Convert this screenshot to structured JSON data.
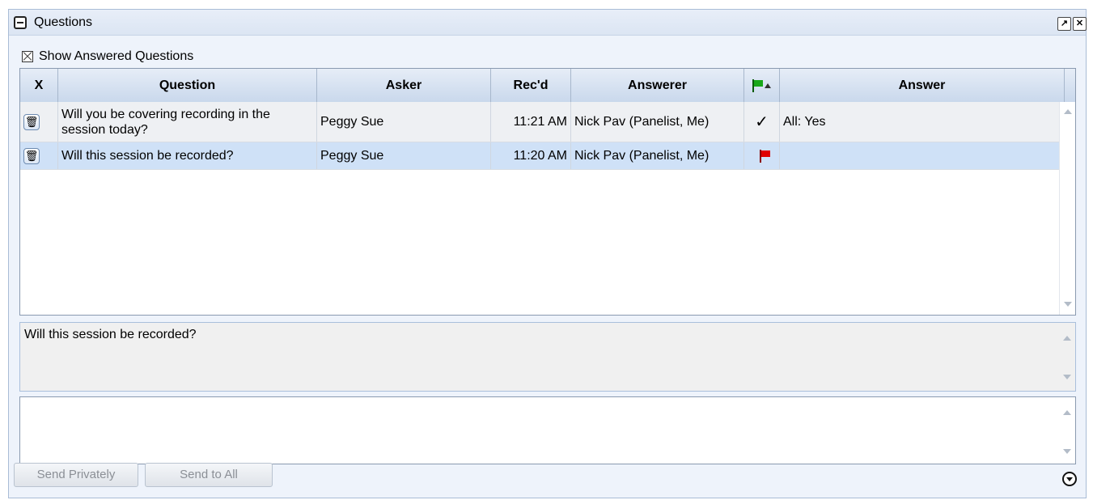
{
  "panel": {
    "title": "Questions",
    "popout_icon": "popout-icon",
    "close_icon": "close-icon"
  },
  "filter": {
    "show_answered_label": "Show Answered Questions",
    "show_answered_checked": true
  },
  "table": {
    "columns": [
      "X",
      "Question",
      "Asker",
      "Rec'd",
      "Answerer",
      "",
      "Answer"
    ],
    "rows": [
      {
        "question_line1": "Will you be covering recording in the",
        "question_line2": "session today?",
        "asker": "Peggy Sue",
        "received": "11:21 AM",
        "answerer": "Nick Pav (Panelist, Me)",
        "status": "✓",
        "answer": "All: Yes"
      },
      {
        "question_line1": "Will this session be recorded?",
        "question_line2": "",
        "asker": "Peggy Sue",
        "received": "11:20 AM",
        "answerer": "Nick Pav (Panelist, Me)",
        "status": "",
        "answer": ""
      }
    ]
  },
  "preview": {
    "text": "Will this session be recorded?"
  },
  "reply": {
    "value": ""
  },
  "buttons": {
    "send_privately": "Send Privately",
    "send_to_all": "Send to All"
  },
  "colors": {
    "selected_row": "#cfe1f7",
    "flag_red": "#e00000",
    "flag_green": "#18a818"
  }
}
